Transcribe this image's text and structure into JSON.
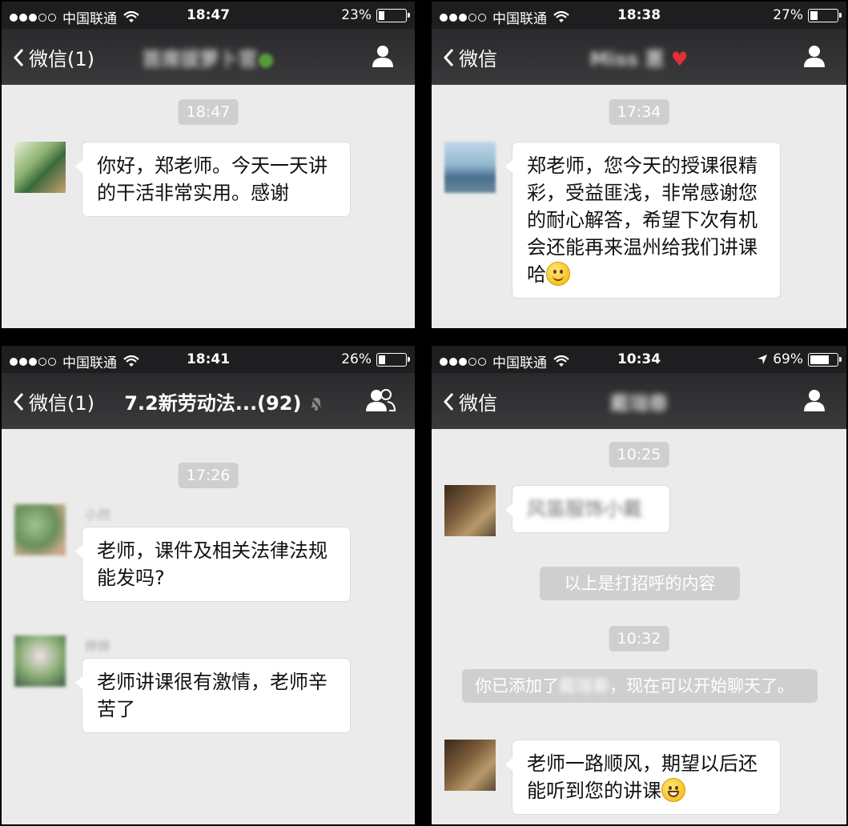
{
  "panels": [
    {
      "status": {
        "carrier": "中国联通",
        "time": "18:47",
        "battery": "23%",
        "battery_level": 0.23
      },
      "nav": {
        "back": "微信(1)",
        "title": "首席拔萝卜官",
        "user_icon": "user-icon"
      },
      "time_chip": "18:47",
      "messages": [
        {
          "text": "你好，郑老师。今天一天讲的干活非常实用。感谢"
        }
      ]
    },
    {
      "status": {
        "carrier": "中国联通",
        "time": "18:38",
        "battery": "27%",
        "battery_level": 0.27
      },
      "nav": {
        "back": "微信",
        "title": "Miss 蒽",
        "user_icon": "user-icon"
      },
      "time_chip": "17:34",
      "messages": [
        {
          "text": "郑老师，您今天的授课很精彩，受益匪浅，非常感谢您的耐心解答，希望下次有机会还能再来温州给我们讲课哈",
          "emoji": "smile-emoji"
        }
      ]
    },
    {
      "status": {
        "carrier": "中国联通",
        "time": "18:41",
        "battery": "26%",
        "battery_level": 0.26
      },
      "nav": {
        "back": "微信(1)",
        "title": "7.2新劳动法...(92)",
        "user_icon": "group-icon",
        "muted_icon": "mute-bell-icon"
      },
      "time_chip": "17:26",
      "messages": [
        {
          "sender": "小然",
          "text": "老师，课件及相关法律法规能发吗?"
        },
        {
          "sender": "婷婷",
          "text": "老师讲课很有激情，老师辛苦了"
        }
      ]
    },
    {
      "status": {
        "carrier": "中国联通",
        "time": "10:34",
        "battery": "69%",
        "battery_level": 0.69,
        "location_icon": "location-arrow-icon"
      },
      "nav": {
        "back": "微信",
        "title": "戴瑞春",
        "user_icon": "user-icon"
      },
      "time_chip_1": "10:25",
      "greeting": "风笛服饰小戴",
      "system_1": "以上是打招呼的内容",
      "time_chip_2": "10:32",
      "system_2_pre": "你已添加了",
      "system_2_name": "戴瑞春",
      "system_2_post": "，现在可以开始聊天了。",
      "messages": [
        {
          "text": "老师一路顺风，期望以后还能听到您的讲课",
          "emoji": "grin-emoji"
        }
      ]
    }
  ]
}
